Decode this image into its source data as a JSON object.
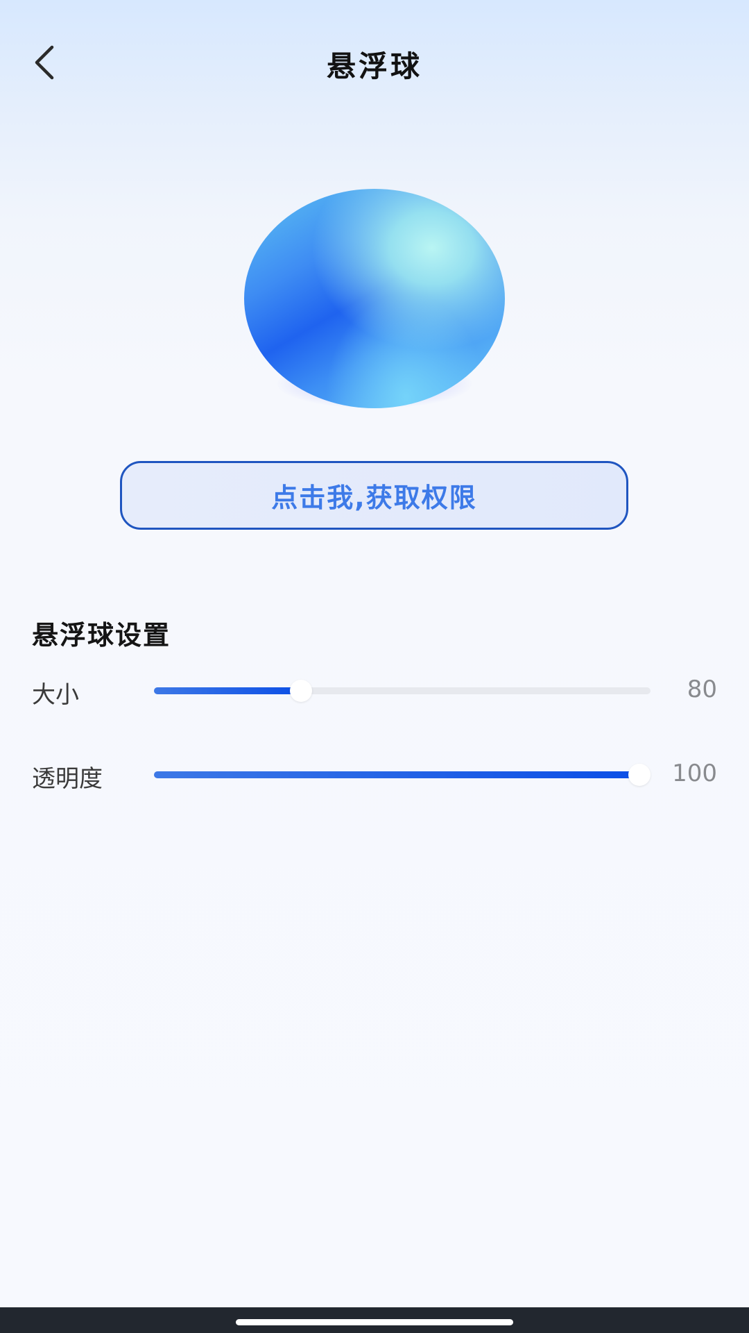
{
  "header": {
    "title": "悬浮球",
    "back_icon": "chevron-left-icon"
  },
  "ball": {
    "colors": {
      "deep": "#1f63ef",
      "mid": "#3e8cf3",
      "light": "#6ecdf7",
      "highlight": "#b9f5f3"
    }
  },
  "permission_button": {
    "label": "点击我,获取权限",
    "border_color": "#1f55c0",
    "text_color": "#3d7ae8"
  },
  "settings": {
    "section_title": "悬浮球设置",
    "items": [
      {
        "key": "size",
        "label": "大小",
        "value": "80",
        "fraction": 0.296
      },
      {
        "key": "opacity",
        "label": "透明度",
        "value": "100",
        "fraction": 0.977
      }
    ],
    "accent_color": "#0c4fe6"
  },
  "system_nav": {
    "background": "#22272f"
  }
}
